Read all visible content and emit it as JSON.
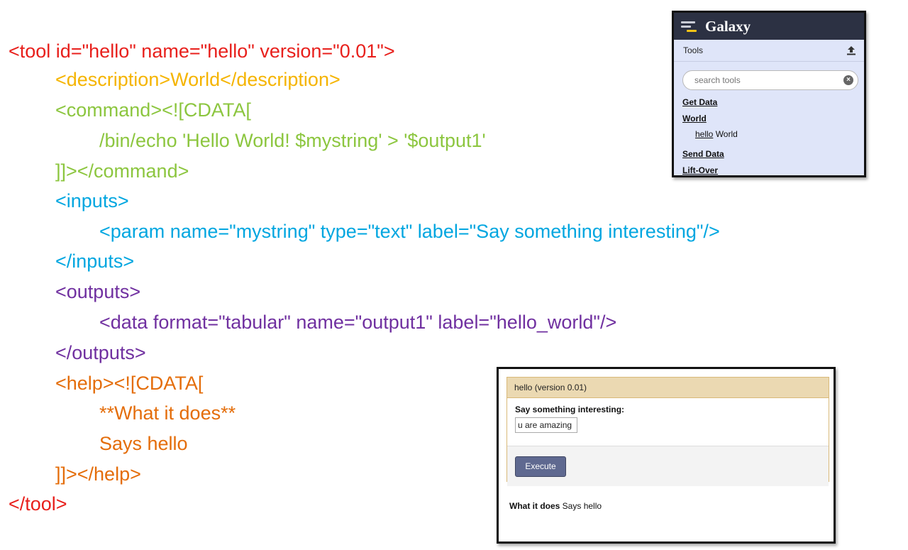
{
  "code_lines": [
    "<tool id=\"hello\" name=\"hello\" version=\"0.01\">",
    "<description>World</description>",
    "<command><![CDATA[",
    "/bin/echo 'Hello World! $mystring' > '$output1'",
    "]]></command>",
    "<inputs>",
    "<param name=\"mystring\" type=\"text\" label=\"Say something interesting\"/>",
    "</inputs>",
    "<outputs>",
    "<data format=\"tabular\" name=\"output1\" label=\"hello_world\"/>",
    "</outputs>",
    "<help><![CDATA[",
    "**What it does**",
    "Says hello",
    "]]></help>",
    "</tool>"
  ],
  "colors": {
    "tool": "#e8201c",
    "description": "#f5b400",
    "command": "#8cc63f",
    "inputs": "#00a6e0",
    "outputs": "#7030a0",
    "help": "#e46d0a"
  },
  "galaxy": {
    "brand": "Galaxy",
    "tools_title": "Tools",
    "upload_icon": "upload-icon",
    "search_placeholder": "search tools",
    "sections": {
      "get_data": "Get Data",
      "world": "World",
      "send_data": "Send Data",
      "lift_over": "Lift-Over"
    },
    "tool_item": {
      "name": "hello",
      "desc": " World"
    }
  },
  "form": {
    "title": "hello (version 0.01)",
    "param_label": "Say something interesting:",
    "param_value": "u are amazing",
    "execute_label": "Execute",
    "help_bold": "What it does",
    "help_text": " Says hello"
  }
}
